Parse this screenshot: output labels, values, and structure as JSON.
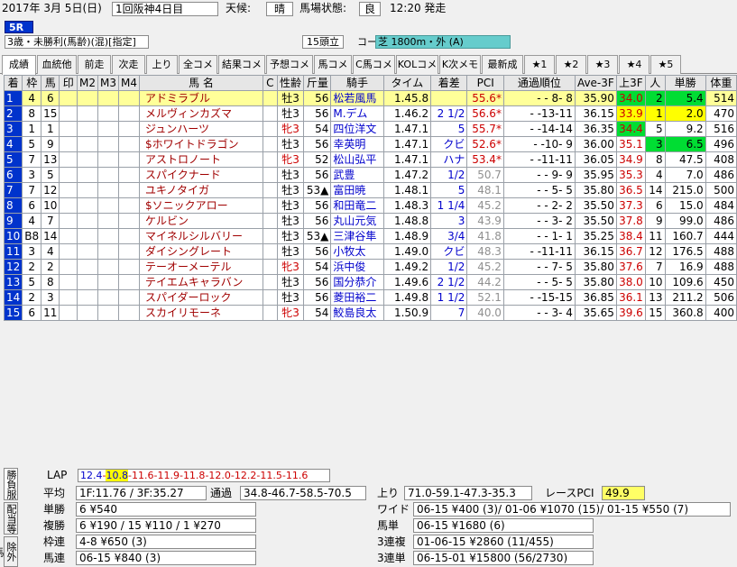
{
  "header": {
    "date": "2017年 3月 5日(日)",
    "meeting": "1回阪神4日目",
    "weather_label": "天候:",
    "weather": "晴",
    "track_label": "馬場状態:",
    "track": "良",
    "start_time": "12:20 発走"
  },
  "race": {
    "number": "5R",
    "conditions": "3歳・未勝利(馬齢)(混)[指定]",
    "heads": "15頭立",
    "course_label": "コース図",
    "course": "芝 1800m・外 (A)"
  },
  "tabs": [
    "成績",
    "血統他",
    "前走",
    "次走",
    "上り",
    "全コメ",
    "結果コメ",
    "予想コメ",
    "馬コメ",
    "C馬コメ",
    "KOLコメ",
    "K次メモ",
    "最新成",
    "★1",
    "★2",
    "★3",
    "★4",
    "★5"
  ],
  "columns": [
    "着",
    "枠",
    "馬",
    "印",
    "M2",
    "M3",
    "M4",
    "馬 名",
    "C",
    "性齢",
    "斤量",
    "騎手",
    "タイム",
    "着差",
    "PCI",
    "通過順位",
    "Ave-3F",
    "上3F",
    "人",
    "単勝",
    "体重"
  ],
  "rows": [
    {
      "rank": "1",
      "waku": "4",
      "uma": "6",
      "name": "アドミラブル",
      "sexage": "牡3",
      "weight": "56",
      "jockey": "松若風馬",
      "time": "1.45.8",
      "margin": "",
      "pci": "55.6*",
      "pass": "- - 8- 8",
      "ave3f": "35.90",
      "up3f": "34.0",
      "ninki": "2",
      "odds": "5.4",
      "bw": "514"
    },
    {
      "rank": "2",
      "waku": "8",
      "uma": "15",
      "name": "メルヴィンカズマ",
      "sexage": "牡3",
      "weight": "56",
      "jockey": "M.デム",
      "time": "1.46.2",
      "margin": "2 1/2",
      "pci": "56.6*",
      "pass": "- -13-11",
      "ave3f": "36.15",
      "up3f": "33.9",
      "ninki": "1",
      "odds": "2.0",
      "bw": "470"
    },
    {
      "rank": "3",
      "waku": "1",
      "uma": "1",
      "name": "ジュンハーツ",
      "sexage": "牝3",
      "weight": "54",
      "jockey": "四位洋文",
      "time": "1.47.1",
      "margin": "5",
      "pci": "55.7*",
      "pass": "- -14-14",
      "ave3f": "36.35",
      "up3f": "34.4",
      "ninki": "5",
      "odds": "9.2",
      "bw": "516"
    },
    {
      "rank": "4",
      "waku": "5",
      "uma": "9",
      "name": "$ホワイトドラゴン",
      "sexage": "牡3",
      "weight": "56",
      "jockey": "幸英明",
      "time": "1.47.1",
      "margin": "クビ",
      "pci": "52.6*",
      "pass": "- -10- 9",
      "ave3f": "36.00",
      "up3f": "35.1",
      "ninki": "3",
      "odds": "6.5",
      "bw": "496"
    },
    {
      "rank": "5",
      "waku": "7",
      "uma": "13",
      "name": "アストロノート",
      "sexage": "牝3",
      "weight": "52",
      "jockey": "松山弘平",
      "time": "1.47.1",
      "margin": "ハナ",
      "pci": "53.4*",
      "pass": "- -11-11",
      "ave3f": "36.05",
      "up3f": "34.9",
      "ninki": "8",
      "odds": "47.5",
      "bw": "408"
    },
    {
      "rank": "6",
      "waku": "3",
      "uma": "5",
      "name": "スパイクナード",
      "sexage": "牡3",
      "weight": "56",
      "jockey": "武豊",
      "time": "1.47.2",
      "margin": "1/2",
      "pci": "50.7",
      "pass": "- - 9- 9",
      "ave3f": "35.95",
      "up3f": "35.3",
      "ninki": "4",
      "odds": "7.0",
      "bw": "486"
    },
    {
      "rank": "7",
      "waku": "7",
      "uma": "12",
      "name": "ユキノタイガ",
      "sexage": "牡3",
      "weight": "53▲",
      "jockey": "富田暁",
      "time": "1.48.1",
      "margin": "5",
      "pci": "48.1",
      "pass": "- - 5- 5",
      "ave3f": "35.80",
      "up3f": "36.5",
      "ninki": "14",
      "odds": "215.0",
      "bw": "500"
    },
    {
      "rank": "8",
      "waku": "6",
      "uma": "10",
      "name": "$ソニックアロー",
      "sexage": "牡3",
      "weight": "56",
      "jockey": "和田竜二",
      "time": "1.48.3",
      "margin": "1 1/4",
      "pci": "45.2",
      "pass": "- - 2- 2",
      "ave3f": "35.50",
      "up3f": "37.3",
      "ninki": "6",
      "odds": "15.0",
      "bw": "484"
    },
    {
      "rank": "9",
      "waku": "4",
      "uma": "7",
      "name": "ケルビン",
      "sexage": "牡3",
      "weight": "56",
      "jockey": "丸山元気",
      "time": "1.48.8",
      "margin": "3",
      "pci": "43.9",
      "pass": "- - 3- 2",
      "ave3f": "35.50",
      "up3f": "37.8",
      "ninki": "9",
      "odds": "99.0",
      "bw": "486"
    },
    {
      "rank": "10",
      "waku": "B8",
      "uma": "14",
      "name": "マイネルシルバリー",
      "sexage": "牡3",
      "weight": "53▲",
      "jockey": "三津谷隼",
      "time": "1.48.9",
      "margin": "3/4",
      "pci": "41.8",
      "pass": "- - 1- 1",
      "ave3f": "35.25",
      "up3f": "38.4",
      "ninki": "11",
      "odds": "160.7",
      "bw": "444"
    },
    {
      "rank": "11",
      "waku": "3",
      "uma": "4",
      "name": "ダイシングレート",
      "sexage": "牡3",
      "weight": "56",
      "jockey": "小牧太",
      "time": "1.49.0",
      "margin": "クビ",
      "pci": "48.3",
      "pass": "- -11-11",
      "ave3f": "36.15",
      "up3f": "36.7",
      "ninki": "12",
      "odds": "176.5",
      "bw": "488"
    },
    {
      "rank": "12",
      "waku": "2",
      "uma": "2",
      "name": "テーオーメーテル",
      "sexage": "牝3",
      "weight": "54",
      "jockey": "浜中俊",
      "time": "1.49.2",
      "margin": "1/2",
      "pci": "45.2",
      "pass": "- - 7- 5",
      "ave3f": "35.80",
      "up3f": "37.6",
      "ninki": "7",
      "odds": "16.9",
      "bw": "488"
    },
    {
      "rank": "13",
      "waku": "5",
      "uma": "8",
      "name": "テイエムキャラバン",
      "sexage": "牡3",
      "weight": "56",
      "jockey": "国分恭介",
      "time": "1.49.6",
      "margin": "2 1/2",
      "pci": "44.2",
      "pass": "- - 5- 5",
      "ave3f": "35.80",
      "up3f": "38.0",
      "ninki": "10",
      "odds": "109.6",
      "bw": "450"
    },
    {
      "rank": "14",
      "waku": "2",
      "uma": "3",
      "name": "スパイダーロック",
      "sexage": "牡3",
      "weight": "56",
      "jockey": "菱田裕二",
      "time": "1.49.8",
      "margin": "1 1/2",
      "pci": "52.1",
      "pass": "- -15-15",
      "ave3f": "36.85",
      "up3f": "36.1",
      "ninki": "13",
      "odds": "211.2",
      "bw": "506"
    },
    {
      "rank": "15",
      "waku": "6",
      "uma": "11",
      "name": "スカイリモーネ",
      "sexage": "牝3",
      "weight": "54",
      "jockey": "鮫島良太",
      "time": "1.50.9",
      "margin": "7",
      "pci": "40.0",
      "pass": "- - 3- 4",
      "ave3f": "35.65",
      "up3f": "39.6",
      "ninki": "15",
      "odds": "360.8",
      "bw": "400"
    }
  ],
  "laps": [
    "12.4",
    "10.8",
    "11.6",
    "11.9",
    "11.8",
    "12.0",
    "12.2",
    "11.5",
    "11.6"
  ],
  "lap_highlight_index": 1,
  "summary": {
    "lap_label": "LAP",
    "avg_label": "平均",
    "avg_value": "1F:11.76 / 3F:35.27",
    "passing_label": "通過",
    "passing_value": "34.8-46.7-58.5-70.5",
    "agari_label": "上り",
    "agari_value": "71.0-59.1-47.3-35.3",
    "race_pci_label": "レースPCI",
    "race_pci_value": "49.9"
  },
  "payouts": {
    "tansho_label": "単勝",
    "tansho": "6 ¥540",
    "fukusho_label": "複勝",
    "fukusho": "6 ¥190 / 15 ¥110 / 1 ¥270",
    "wakuren_label": "枠連",
    "wakuren": "4-8 ¥650 (3)",
    "umaren_label": "馬連",
    "umaren": "06-15 ¥840 (3)",
    "wide_label": "ワイド",
    "wide": "06-15 ¥400 (3)/ 01-06 ¥1070 (15)/ 01-15 ¥550 (7)",
    "umatan_label": "馬単",
    "umatan": "06-15 ¥1680 (6)",
    "sanrenpuku_label": "3連複",
    "sanrenpuku": "01-06-15 ¥2860 (11/455)",
    "sanrentan_label": "3連単",
    "sanrentan": "06-15-01 ¥15800 (56/2730)"
  },
  "side_tabs": [
    "勝負服",
    "配当等",
    "除外馬"
  ]
}
